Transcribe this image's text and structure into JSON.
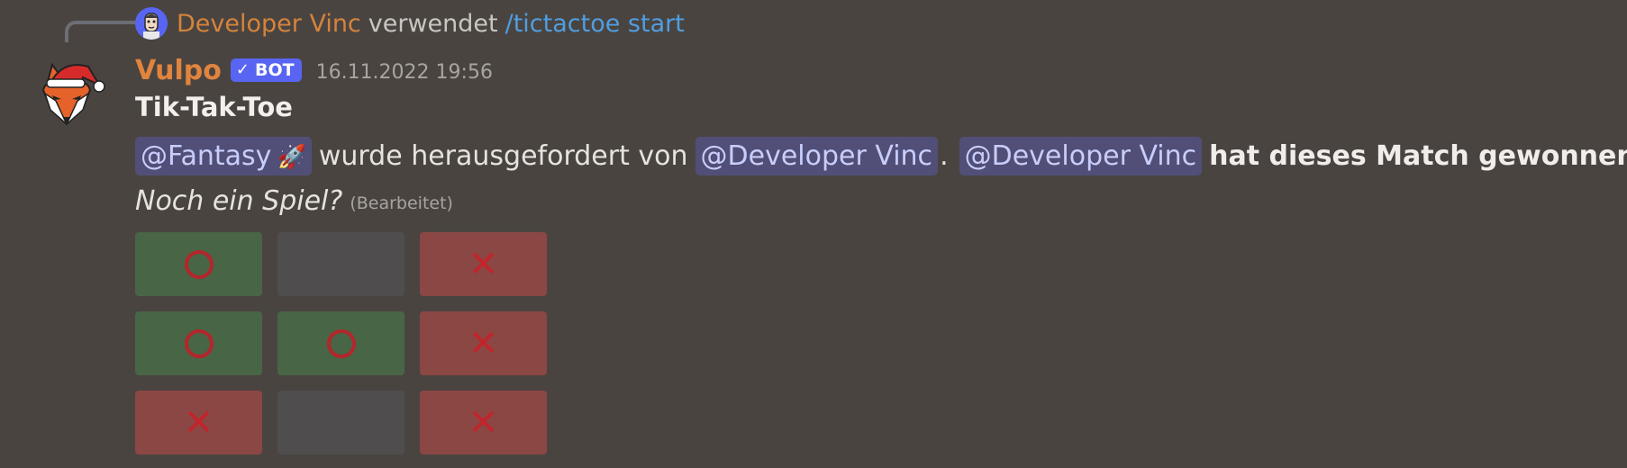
{
  "reply": {
    "user": "Developer Vinc",
    "verb": "verwendet",
    "command": "/tictactoe start"
  },
  "message": {
    "username": "Vulpo",
    "bot_tag": "BOT",
    "timestamp": "16.11.2022 19:56",
    "title": "Tik-Tak-Toe",
    "mention_challenged": "@Fantasy",
    "rocket": "🚀",
    "challenged_text": "wurde herausgefordert von",
    "mention_challenger": "@Developer Vinc",
    "period": ".",
    "mention_winner": "@Developer Vinc",
    "winner_text": "hat dieses Match gewonnen.",
    "question": "Noch ein Spiel?",
    "edited": "(Bearbeitet)"
  },
  "board": {
    "cells": [
      "O",
      "",
      "X",
      "O",
      "O",
      "X",
      "X",
      "",
      "X"
    ]
  },
  "colors": {
    "background": "#4a4441",
    "username": "#e0843e",
    "mention_bg": "#514f78",
    "cell_o": "#486545",
    "cell_x": "#8b4744",
    "cell_empty": "#4f4d4d",
    "mark": "#c1252b"
  },
  "icons": {
    "reply_avatar": "cartoon-person-avatar-icon",
    "bot_avatar": "fox-santa-hat-icon",
    "verified": "checkmark-icon"
  }
}
